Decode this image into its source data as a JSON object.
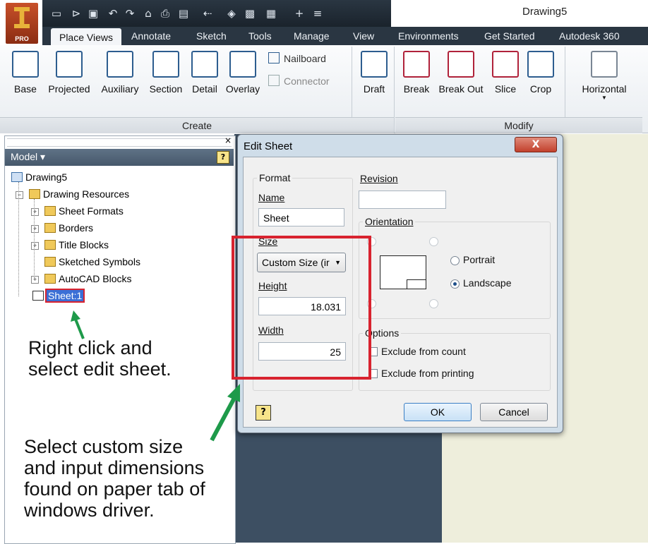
{
  "app": {
    "document_title": "Drawing5",
    "logo_badge": "PRO",
    "tabs": [
      "Place Views",
      "Annotate",
      "Sketch",
      "Tools",
      "Manage",
      "View",
      "Environments",
      "Get Started",
      "Autodesk 360"
    ],
    "active_tab": "Place Views"
  },
  "ribbon": {
    "create_buttons": [
      "Base",
      "Projected",
      "Auxiliary",
      "Section",
      "Detail",
      "Overlay"
    ],
    "small_buttons": [
      "Nailboard",
      "Connector"
    ],
    "draft": "Draft",
    "modify_buttons": [
      "Break",
      "Break Out",
      "Slice",
      "Crop"
    ],
    "horizontal": "Horizontal",
    "create_panel": "Create",
    "modify_panel": "Modify"
  },
  "browser": {
    "header": "Model ▾",
    "help": "?",
    "tree": [
      {
        "label": "Drawing5"
      },
      {
        "label": "Drawing Resources"
      },
      {
        "label": "Sheet Formats"
      },
      {
        "label": "Borders"
      },
      {
        "label": "Title Blocks"
      },
      {
        "label": "Sketched Symbols"
      },
      {
        "label": "AutoCAD Blocks"
      },
      {
        "label": "Sheet:1"
      }
    ]
  },
  "notes": {
    "right_click": [
      "Right click and",
      "select edit sheet."
    ],
    "custom_size": [
      "Select custom size",
      "and input dimensions",
      "found on paper tab of",
      "windows driver."
    ]
  },
  "dialog": {
    "title": "Edit Sheet",
    "close": "X",
    "format_group": "Format",
    "name_label": "Name",
    "name_value": "Sheet",
    "size_label": "Size",
    "size_value": "Custom Size (ir",
    "height_label": "Height",
    "height_value": "18.031",
    "width_label": "Width",
    "width_value": "25",
    "revision_label": "Revision",
    "revision_value": "",
    "orientation_group": "Orientation",
    "portrait": "Portrait",
    "landscape": "Landscape",
    "orientation_selected": "Landscape",
    "options_group": "Options",
    "exclude_count": "Exclude from count",
    "exclude_printing": "Exclude from printing",
    "help": "?",
    "ok": "OK",
    "cancel": "Cancel"
  },
  "colors": {
    "annotation_red": "#d8232f",
    "annotation_green": "#1e9a4a",
    "selection_blue": "#3b6fd6"
  }
}
